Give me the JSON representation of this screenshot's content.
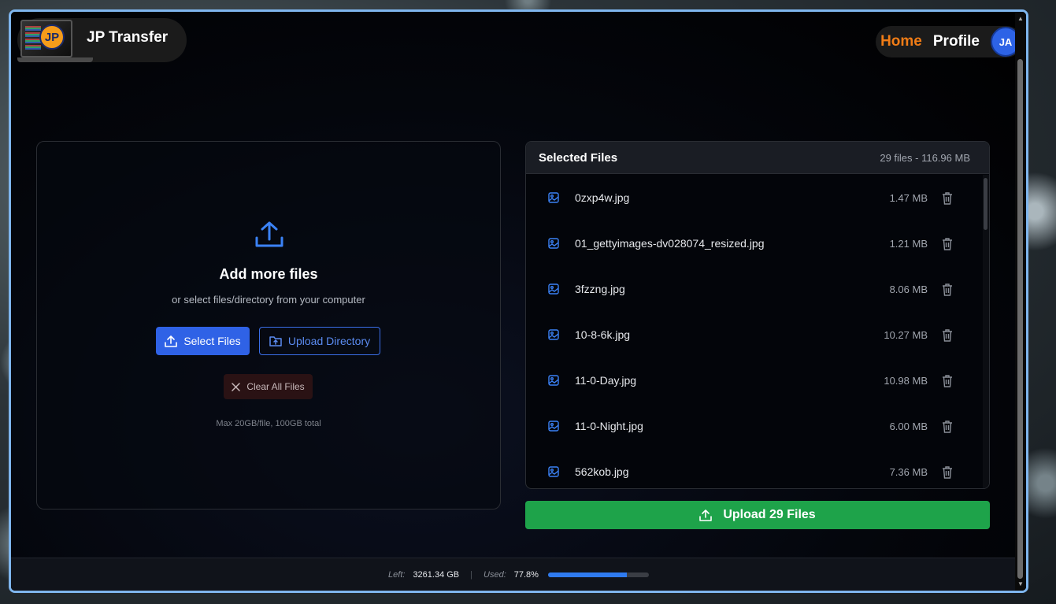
{
  "app": {
    "title": "JP Transfer",
    "logo_text": "JP"
  },
  "nav": {
    "home": "Home",
    "profile": "Profile",
    "avatar": "JA"
  },
  "drop": {
    "title": "Add more files",
    "subtitle": "or select files/directory from your computer",
    "select_label": "Select Files",
    "directory_label": "Upload Directory",
    "clear_label": "Clear All Files",
    "limits": "Max 20GB/file, 100GB total"
  },
  "files": {
    "title": "Selected Files",
    "summary": "29 files - 116.96 MB",
    "items": [
      {
        "name": "0zxp4w.jpg",
        "size": "1.47 MB"
      },
      {
        "name": "01_gettyimages-dv028074_resized.jpg",
        "size": "1.21 MB"
      },
      {
        "name": "3fzzng.jpg",
        "size": "8.06 MB"
      },
      {
        "name": "10-8-6k.jpg",
        "size": "10.27 MB"
      },
      {
        "name": "11-0-Day.jpg",
        "size": "10.98 MB"
      },
      {
        "name": "11-0-Night.jpg",
        "size": "6.00 MB"
      },
      {
        "name": "562kob.jpg",
        "size": "7.36 MB"
      }
    ]
  },
  "upload_button": "Upload 29 Files",
  "footer": {
    "left_label": "Left:",
    "left_value": "3261.34 GB",
    "used_label": "Used:",
    "used_value": "77.8%",
    "used_fraction": 0.778
  },
  "colors": {
    "accent": "#2f62e6",
    "upload": "#1ea34a",
    "home": "#f07c16"
  }
}
